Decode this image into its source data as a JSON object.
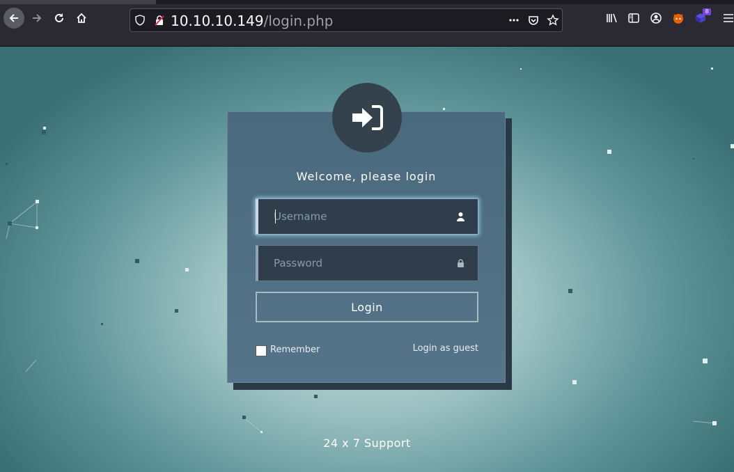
{
  "browser": {
    "url_host": "10.10.10.149",
    "url_path": "/login.php",
    "extensions_badge": "8",
    "icons": [
      "back-icon",
      "forward-icon",
      "reload-icon",
      "home-icon",
      "shield-icon",
      "insecure-lock-icon",
      "more-icon",
      "pocket-icon",
      "bookmark-star-icon",
      "library-icon",
      "sidebar-icon",
      "account-icon",
      "extension-fox-icon",
      "extension-cube-icon",
      "menu-icon"
    ]
  },
  "login": {
    "welcome": "Welcome, please login",
    "username_placeholder": "Username",
    "password_placeholder": "Password",
    "login_button": "Login",
    "remember_label": "Remember",
    "guest_link": "Login as guest"
  },
  "footer": {
    "support": "24 x 7 Support"
  },
  "colors": {
    "card": "#4d6d82",
    "avatar": "#34424e",
    "field": "#2f3e4a",
    "accent_glow": "#9ccbe8",
    "page_center": "#c9dcdc",
    "page_edge": "#3b7176"
  }
}
